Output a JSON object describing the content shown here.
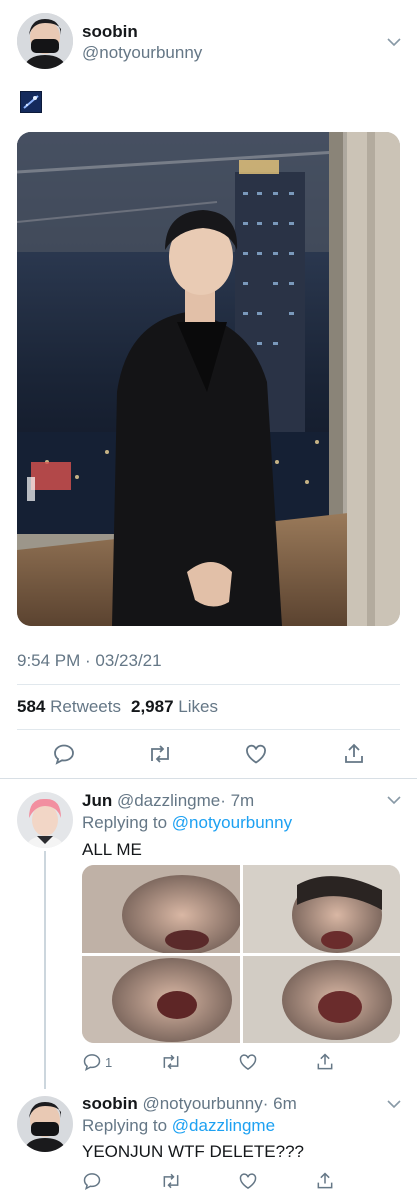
{
  "main_tweet": {
    "display_name": "soobin",
    "handle": "@notyourbunny",
    "timestamp": "9:54 PM · 03/23/21",
    "retweets_count": "584",
    "retweets_label": "Retweets",
    "likes_count": "2,987",
    "likes_label": "Likes"
  },
  "replies": [
    {
      "display_name": "Jun",
      "handle": "@dazzlingme",
      "time": "· 7m",
      "replying_prefix": "Replying to",
      "replying_to": "@notyourbunny",
      "text": "ALL ME",
      "reply_count": "1"
    },
    {
      "display_name": "soobin",
      "handle": "@notyourbunny",
      "time": "· 6m",
      "replying_prefix": "Replying to",
      "replying_to": "@dazzlingme",
      "text": "YEONJUN WTF DELETE???"
    }
  ],
  "icons": [
    "chevron-down-icon",
    "reply-icon",
    "retweet-icon",
    "like-icon",
    "share-icon"
  ],
  "colors": {
    "link": "#1da1f2",
    "secondary_text": "#657786",
    "icon": "#657786"
  }
}
